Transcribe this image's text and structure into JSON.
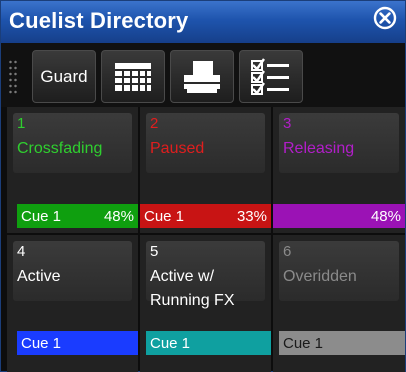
{
  "window": {
    "title": "Cuelist Directory",
    "close_icon": "close-circle-icon"
  },
  "toolbar": {
    "guard_label": "Guard",
    "buttons": [
      {
        "name": "guard-button",
        "label": "Guard"
      },
      {
        "name": "grid-view-button",
        "icon": "grid-icon"
      },
      {
        "name": "printer-button",
        "icon": "printer-icon"
      },
      {
        "name": "checklist-button",
        "icon": "checklist-icon"
      }
    ]
  },
  "cues": [
    {
      "number": "1",
      "name": "Crossfading",
      "cue_label": "Cue 1",
      "percent": "48%",
      "progress": 0.48,
      "text_color": "#2fcf2f",
      "bar_color": "#0f9f0f"
    },
    {
      "number": "2",
      "name": "Paused",
      "cue_label": "Cue 1",
      "percent": "33%",
      "progress": 0.33,
      "text_color": "#e01e1e",
      "bar_color": "#c81414"
    },
    {
      "number": "3",
      "name": "Releasing",
      "cue_label": "",
      "percent": "48%",
      "progress": 0.48,
      "text_color": "#b21ec9",
      "bar_color": "#9b12b5"
    },
    {
      "number": "4",
      "name": "Active",
      "cue_label": "Cue 1",
      "percent": "",
      "text_color": "#ffffff",
      "bar_color": "#1a3cff"
    },
    {
      "number": "5",
      "name": "Active w/ Running FX",
      "cue_label": "Cue 1",
      "percent": "",
      "text_color": "#ffffff",
      "bar_color": "#0fa0a0"
    },
    {
      "number": "6",
      "name": "Overidden",
      "cue_label": "Cue 1",
      "percent": "",
      "text_color": "#8a8a8a",
      "bar_color": "#8c8c8c"
    }
  ]
}
